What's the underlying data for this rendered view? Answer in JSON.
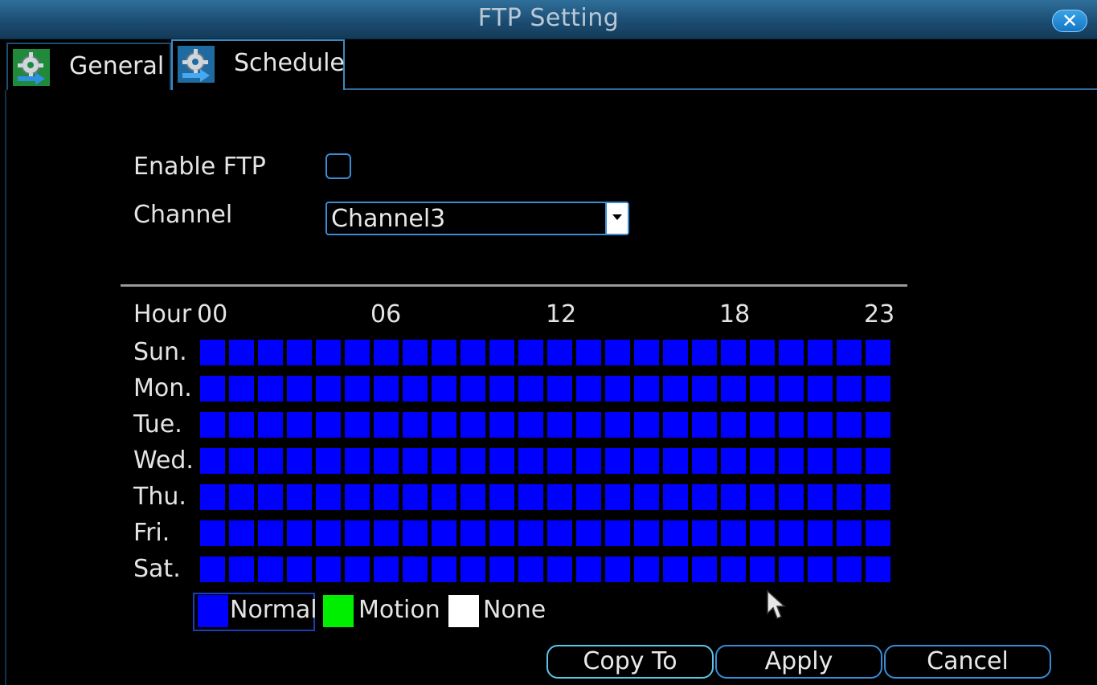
{
  "window": {
    "title": "FTP Setting",
    "close_symbol": "✕"
  },
  "tabs": [
    {
      "label": "General",
      "icon": "gear-arrow-icon",
      "active": false
    },
    {
      "label": "Schedule",
      "icon": "gear-arrow-icon",
      "active": true
    }
  ],
  "form": {
    "enable_ftp_label": "Enable FTP",
    "enable_ftp_checked": false,
    "channel_label": "Channel",
    "channel_value": "Channel3"
  },
  "schedule": {
    "hour_header": "Hour",
    "hour_ticks": [
      "00",
      "06",
      "12",
      "18",
      "23"
    ],
    "days": [
      "Sun.",
      "Mon.",
      "Tue.",
      "Wed.",
      "Thu.",
      "Fri.",
      "Sat."
    ],
    "hours_per_day": 24,
    "cell_mode_all": "Normal",
    "mode_colors": {
      "Normal": "#0000ff",
      "Motion": "#00ee00",
      "None": "#ffffff"
    }
  },
  "legend": {
    "normal": "Normal",
    "motion": "Motion",
    "none": "None"
  },
  "buttons": {
    "copy_to": "Copy To",
    "apply": "Apply",
    "cancel": "Cancel"
  }
}
